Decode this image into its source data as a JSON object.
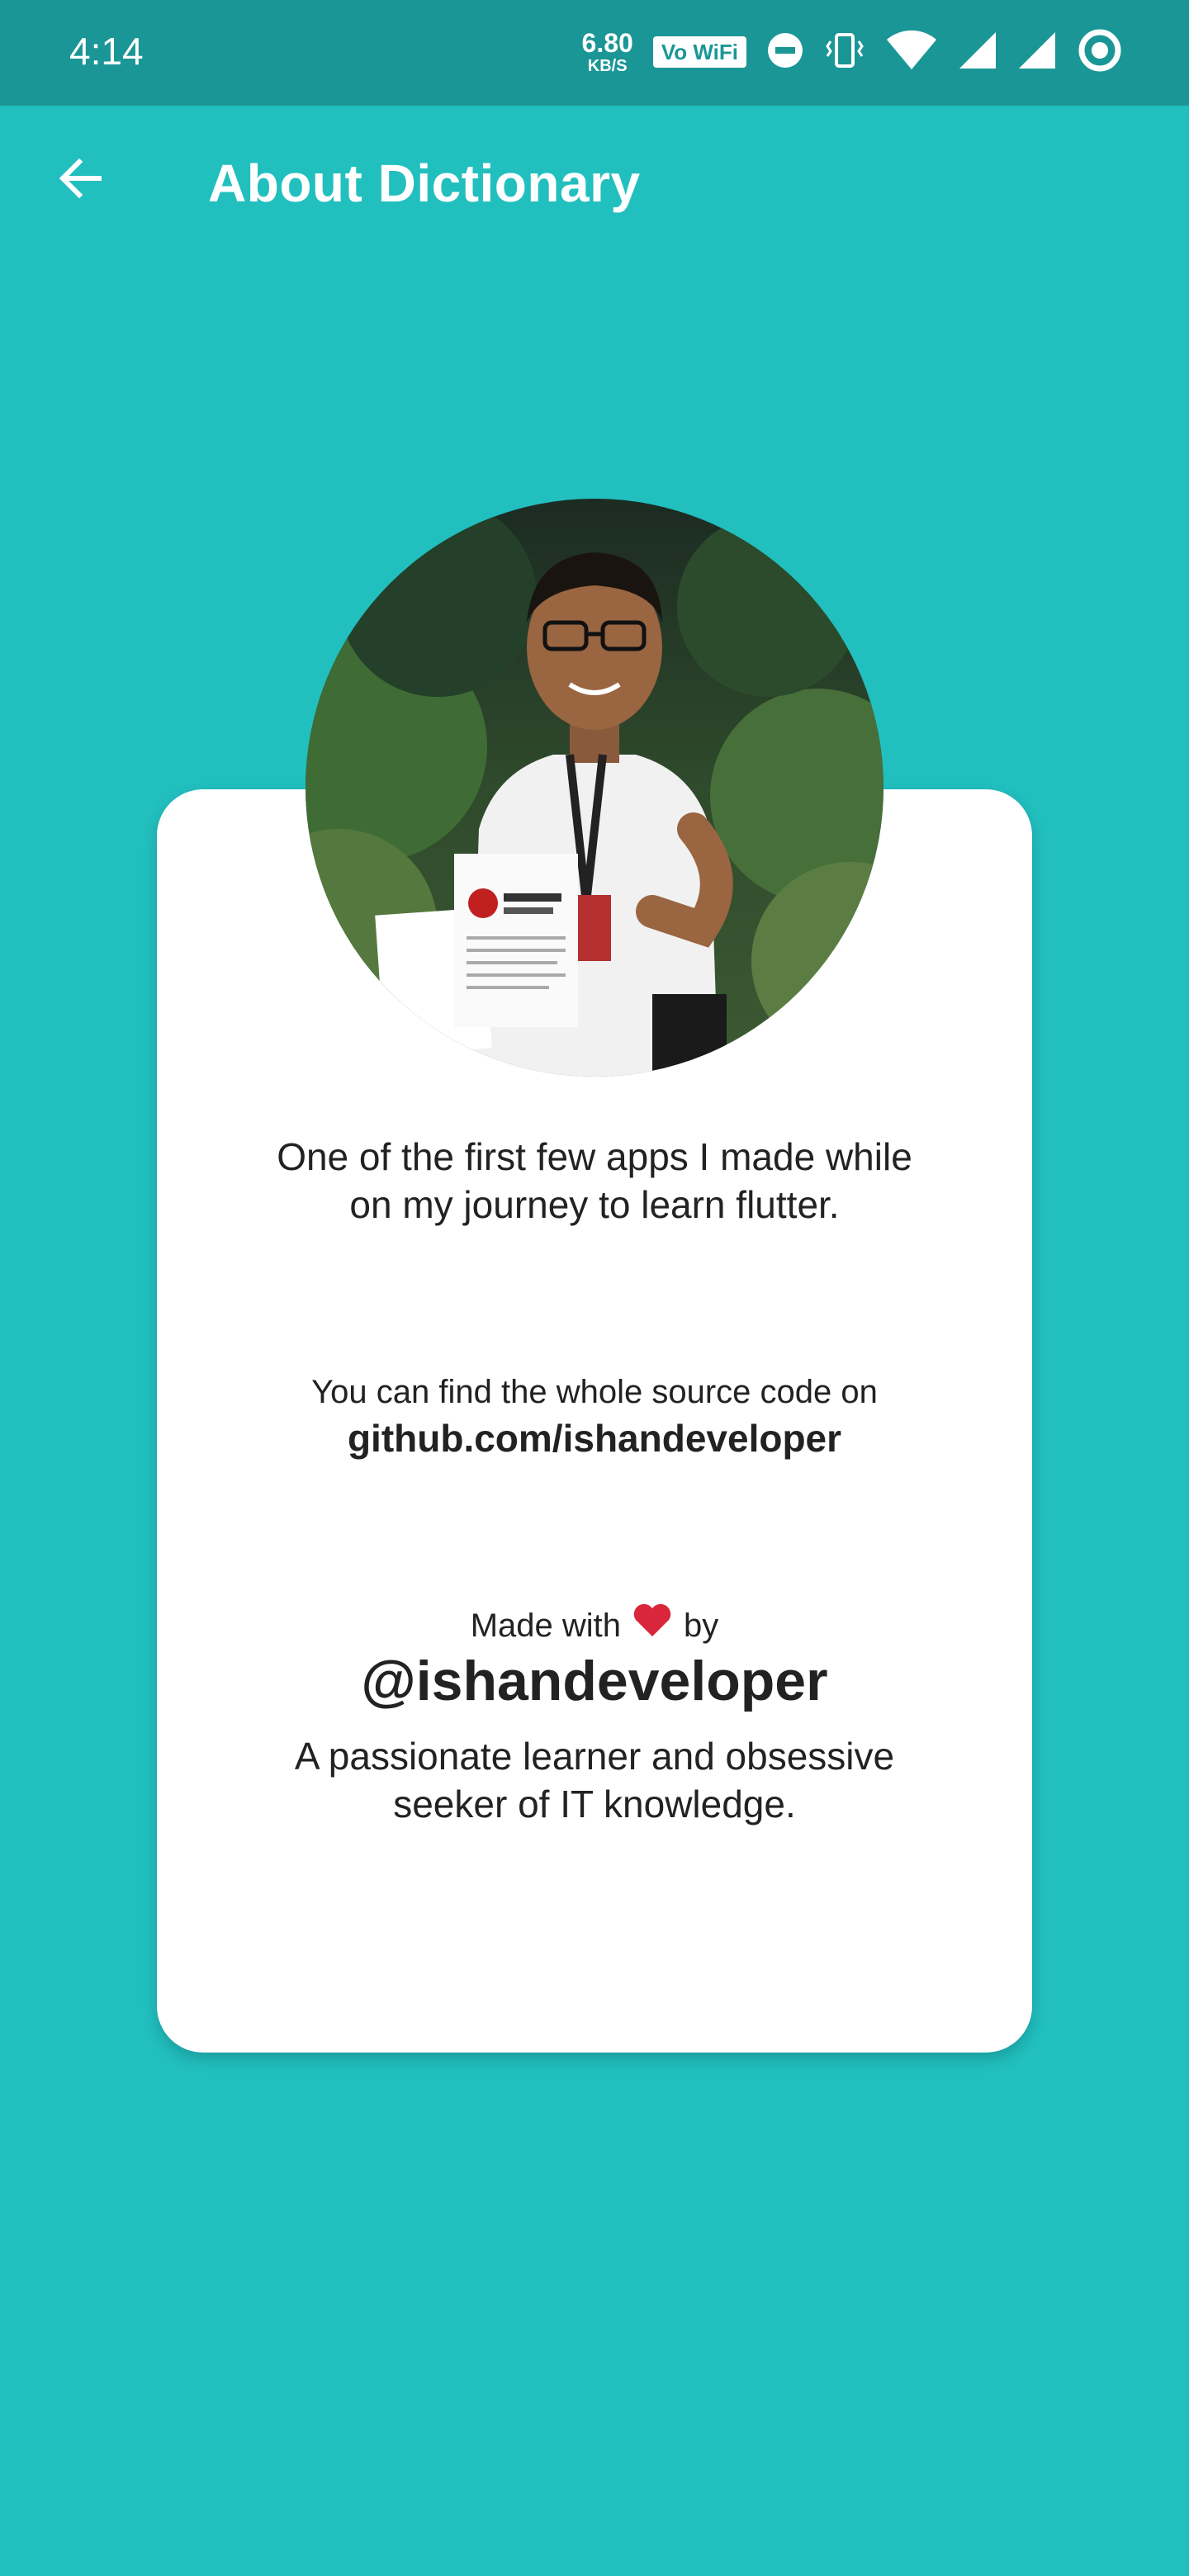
{
  "status_bar": {
    "time": "4:14",
    "speed_value": "6.80",
    "speed_unit": "KB/S",
    "vowifi_label": "Vo WiFi",
    "icons": [
      "do-not-disturb-icon",
      "vibrate-icon",
      "wifi-icon",
      "signal-icon",
      "signal-icon",
      "sync-icon"
    ]
  },
  "app_bar": {
    "title": "About Dictionary",
    "back_icon": "arrow-left-icon"
  },
  "profile": {
    "intro_line1": "One of the first few apps I made while",
    "intro_line2": "on my journey to learn flutter.",
    "source_label": "You can find the whole source code on",
    "source_link": "github.com/ishandeveloper",
    "made_with_prefix": "Made with",
    "made_with_icon": "heart-icon",
    "made_with_suffix": "by",
    "handle": "@ishandeveloper",
    "bio_line1": "A passionate learner and obsessive",
    "bio_line2": "seeker of IT knowledge."
  },
  "colors": {
    "background": "#22bfbf",
    "status_bar": "#1b9696",
    "card": "#ffffff",
    "heart": "#d9263a"
  }
}
